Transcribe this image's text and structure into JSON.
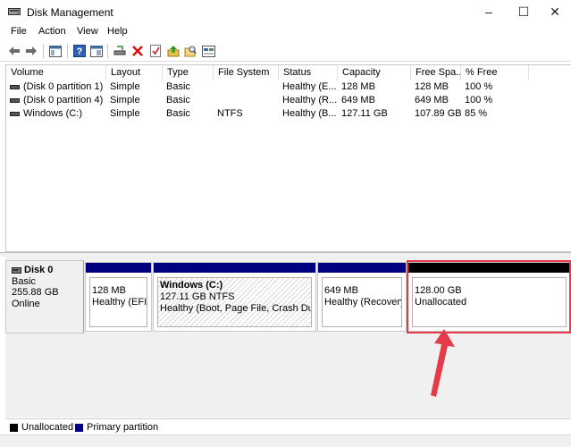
{
  "window": {
    "title": "Disk Management",
    "buttons": {
      "minimize": "–",
      "maximize": "☐",
      "close": "✕"
    }
  },
  "menu": [
    "File",
    "Action",
    "View",
    "Help"
  ],
  "toolbar": {
    "icons": [
      "back-icon",
      "forward-icon",
      "console-tree-icon",
      "help-icon",
      "properties-icon",
      "connect-icon",
      "delete-icon",
      "check-icon",
      "import-icon",
      "search-icon",
      "disk-view-icon"
    ]
  },
  "volumes": {
    "columns": [
      "Volume",
      "Layout",
      "Type",
      "File System",
      "Status",
      "Capacity",
      "Free Spa...",
      "% Free"
    ],
    "rows": [
      [
        "(Disk 0 partition 1)",
        "Simple",
        "Basic",
        "",
        "Healthy (E...",
        "128 MB",
        "128 MB",
        "100 %"
      ],
      [
        "(Disk 0 partition 4)",
        "Simple",
        "Basic",
        "",
        "Healthy (R...",
        "649 MB",
        "649 MB",
        "100 %"
      ],
      [
        "Windows (C:)",
        "Simple",
        "Basic",
        "NTFS",
        "Healthy (B...",
        "127.11 GB",
        "107.89 GB",
        "85 %"
      ]
    ]
  },
  "disk": {
    "name": "Disk 0",
    "type": "Basic",
    "size": "255.88 GB",
    "status": "Online",
    "partitions": [
      {
        "title": "",
        "size": "128 MB",
        "status": "Healthy (EFI S",
        "bar_color": "#000080"
      },
      {
        "title": "Windows  (C:)",
        "size": "127.11 GB NTFS",
        "status": "Healthy (Boot, Page File, Crash Dump,",
        "bar_color": "#000080"
      },
      {
        "title": "",
        "size": "649 MB",
        "status": "Healthy (Recovery P",
        "bar_color": "#000080"
      },
      {
        "title": "",
        "size": "128.00 GB",
        "status": "Unallocated",
        "bar_color": "#000000"
      }
    ]
  },
  "legend": {
    "unallocated": {
      "label": "Unallocated",
      "color": "#000000"
    },
    "primary": {
      "label": "Primary partition",
      "color": "#000080"
    }
  },
  "annotation": {
    "highlight_color": "#e43a4a"
  }
}
